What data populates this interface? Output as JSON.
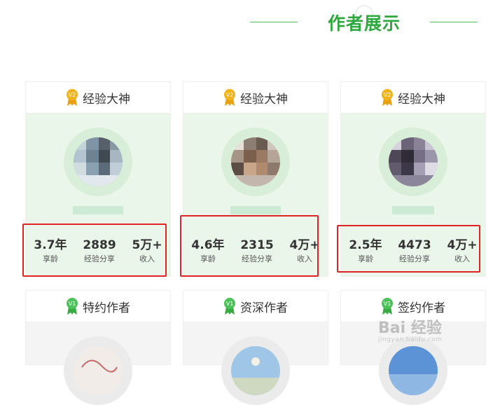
{
  "header": {
    "title": "作者展示"
  },
  "cards": [
    {
      "level": "V2",
      "title": "经验大神",
      "stats": [
        {
          "value": "3.7年",
          "label": "享龄"
        },
        {
          "value": "2889",
          "label": "经验分享"
        },
        {
          "value": "5万+",
          "label": "收入"
        }
      ]
    },
    {
      "level": "V2",
      "title": "经验大神",
      "stats": [
        {
          "value": "4.6年",
          "label": "享龄"
        },
        {
          "value": "2315",
          "label": "经验分享"
        },
        {
          "value": "4万+",
          "label": "收入"
        }
      ]
    },
    {
      "level": "V2",
      "title": "经验大神",
      "stats": [
        {
          "value": "2.5年",
          "label": "享龄"
        },
        {
          "value": "4473",
          "label": "经验分享"
        },
        {
          "value": "4万+",
          "label": "收入"
        }
      ]
    }
  ],
  "cards_row2": [
    {
      "level": "V1",
      "title": "特约作者"
    },
    {
      "level": "V1",
      "title": "资深作者"
    },
    {
      "level": "V1",
      "title": "签约作者"
    }
  ],
  "watermark": {
    "brand": "Bai 经验",
    "url": "jingyan.baidu.com"
  },
  "colors": {
    "accent": "#2fa83f",
    "highlight": "#e02424",
    "gold": "#f2b21a"
  }
}
